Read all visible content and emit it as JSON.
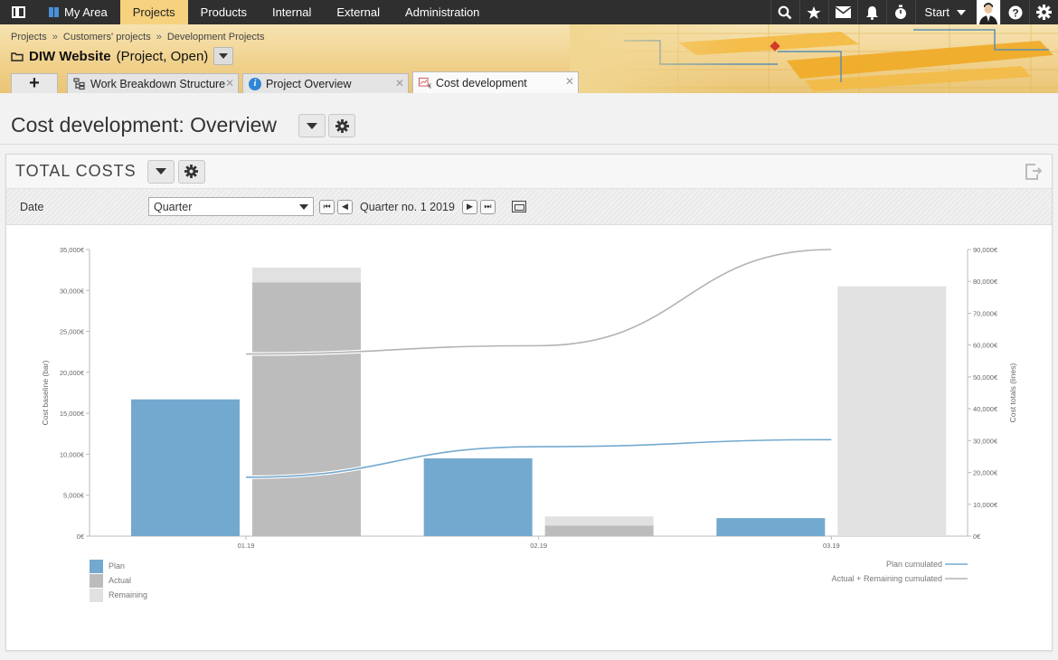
{
  "topnav": {
    "items": [
      {
        "label": "My Area",
        "active": false
      },
      {
        "label": "Projects",
        "active": true
      },
      {
        "label": "Products",
        "active": false
      },
      {
        "label": "Internal",
        "active": false
      },
      {
        "label": "External",
        "active": false
      },
      {
        "label": "Administration",
        "active": false
      }
    ],
    "start_label": "Start"
  },
  "header": {
    "breadcrumb": [
      "Projects",
      "Customers' projects",
      "Development Projects"
    ],
    "project_name": "DIW Website",
    "project_status": "(Project, Open)",
    "tabs": [
      {
        "label": "Work Breakdown Structure",
        "icon": "wbs-icon",
        "active": false
      },
      {
        "label": "Project Overview",
        "icon": "info-icon",
        "active": false
      },
      {
        "label": "Cost development",
        "icon": "cost-icon",
        "active": true
      }
    ],
    "add_tab_label": "+"
  },
  "page": {
    "title": "Cost development: Overview"
  },
  "panel": {
    "title": "TOTAL COSTS",
    "filter_label": "Date",
    "period_select": "Quarter",
    "period_value": "Quarter no. 1 2019"
  },
  "colors": {
    "plan": "#74a9cf",
    "actual": "#bcbcbc",
    "remaining": "#e1e1e1",
    "accent_nav": "#f6d27f"
  },
  "chart_data": {
    "type": "bar",
    "categories": [
      "01.19",
      "02.19",
      "03.19"
    ],
    "series": [
      {
        "name": "Plan",
        "values": [
          16700,
          9500,
          2200
        ]
      },
      {
        "name": "Actual",
        "values": [
          31000,
          1300,
          0
        ]
      },
      {
        "name": "Remaining",
        "values": [
          1800,
          1100,
          30500
        ]
      }
    ],
    "line_series": [
      {
        "name": "Plan cumulated",
        "values": [
          18500,
          28100,
          30300
        ]
      },
      {
        "name": "Actual + Remaining cumulated",
        "values": [
          57200,
          59800,
          90000
        ]
      }
    ],
    "ylabel": "Cost baseline (bar)",
    "ylabel_right": "Cost totals (lines)",
    "ylim": [
      0,
      35000
    ],
    "ylim_right": [
      0,
      90000
    ],
    "yticks": [
      "0€",
      "5,000€",
      "10,000€",
      "15,000€",
      "20,000€",
      "25,000€",
      "30,000€",
      "35,000€"
    ],
    "yticks_right": [
      "0€",
      "10,000€",
      "20,000€",
      "30,000€",
      "40,000€",
      "50,000€",
      "60,000€",
      "70,000€",
      "80,000€",
      "90,000€"
    ],
    "legend_left": [
      "Plan",
      "Actual",
      "Remaining"
    ],
    "legend_right": [
      "Plan cumulated",
      "Actual + Remaining cumulated"
    ]
  }
}
